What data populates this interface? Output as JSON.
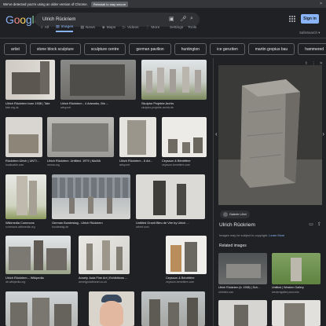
{
  "banner": {
    "message": "We've detected you're using an older version of Chrome.",
    "button": "Reinstall to stay secure",
    "close": "×"
  },
  "header": {
    "logo": "Google",
    "query": "Ulrich Rückriem",
    "signin": "Sign in",
    "safesearch": "SafeSearch ▾",
    "settings": "Settings",
    "tools": "Tools"
  },
  "tabs": [
    {
      "label": "All",
      "icon": "search-icon",
      "active": false
    },
    {
      "label": "Images",
      "icon": "image-icon",
      "active": true
    },
    {
      "label": "News",
      "icon": "news-icon",
      "active": false
    },
    {
      "label": "Maps",
      "icon": "map-icon",
      "active": false
    },
    {
      "label": "Videos",
      "icon": "video-icon",
      "active": false
    },
    {
      "label": "More",
      "icon": "more-icon",
      "active": false
    }
  ],
  "chips": [
    "artist",
    "stone block sculpture",
    "sculpture centre",
    "german pavilion",
    "huntington",
    "ice genziten",
    "martin gropius bau",
    "hammered",
    "circle",
    "hube"
  ],
  "results": [
    {
      "caption": "Ulrich Rückriem born 1938 | Tate",
      "source": "tate.org.uk"
    },
    {
      "caption": "Ulrich Rückriem - 4 Artworks, Bio ...",
      "source": "artsy.net"
    },
    {
      "caption": "Skulptur Projekte Archiv",
      "source": "skulptur-projekte-archiv.de"
    },
    {
      "caption": "Rückriem Ulrich | UNTI...",
      "source": "invaluable.com"
    },
    {
      "caption": "Ulrich Rückriem. Untitled. 1979 | MoMA",
      "source": "moma.org"
    },
    {
      "caption": "Ulrich Rückriem - 6 Art...",
      "source": "artsy.net"
    },
    {
      "caption": "Ceysson & Bénétière",
      "source": "ceysson-benetiere.com"
    },
    {
      "caption": "Wikimedia Commons",
      "source": "commons.wikimedia.org"
    },
    {
      "caption": "German Bundestag - Ulrich Rückriem",
      "source": "bundestag.de"
    },
    {
      "caption": "Untitled Granit Bleu de Vire by Ulrich ...",
      "source": "artnet.com"
    },
    {
      "caption": "Ulrich Rückriem – Wikipedia",
      "source": "de.wikipedia.org"
    },
    {
      "caption": "Annely Juda Fine Art | Exhibitions ...",
      "source": "annelyjudafineart.co.uk"
    },
    {
      "caption": "Ceysson & Bénétière",
      "source": "ceysson-benetiere.com"
    }
  ],
  "panel": {
    "gallery_label": "Galerie Löhrl",
    "title": "Ulrich Rückriem",
    "copyright_text": "Images may be subject to copyright.",
    "learn_more": "Learn More",
    "related_title": "Related images",
    "related": [
      {
        "caption": "Ulrich Rückriem (b. 1938) | Sch...",
        "source": "christies.com"
      },
      {
        "caption": "Untitled | Western Gallery",
        "source": "westerngallery.wwu.edu"
      }
    ]
  }
}
